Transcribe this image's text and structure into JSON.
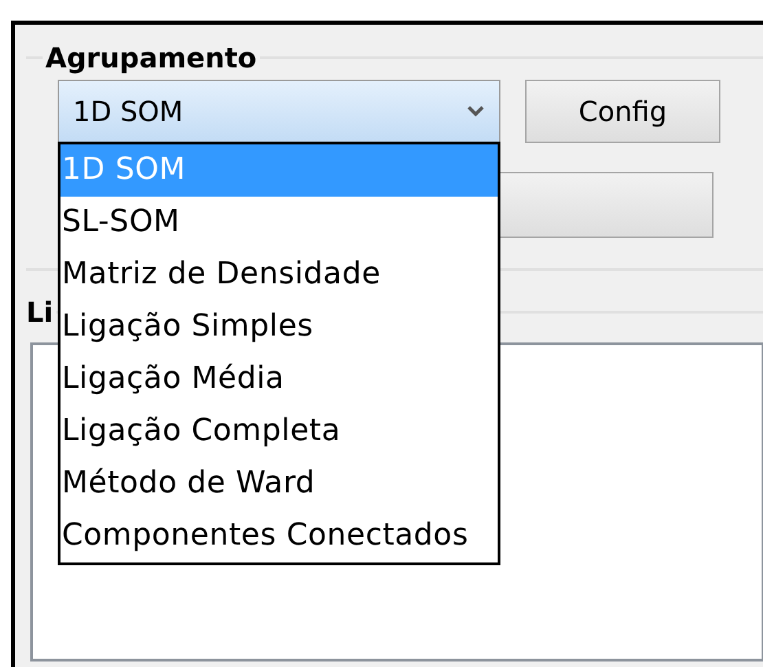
{
  "group": {
    "title": "Agrupamento"
  },
  "combo": {
    "value": "1D SOM",
    "expanded": true
  },
  "config_button": {
    "label": "Config"
  },
  "dropdown": {
    "items": [
      {
        "label": "1D SOM",
        "selected": true
      },
      {
        "label": "SL-SOM",
        "selected": false
      },
      {
        "label": "Matriz de Densidade",
        "selected": false
      },
      {
        "label": "Ligação Simples",
        "selected": false
      },
      {
        "label": "Ligação Média",
        "selected": false
      },
      {
        "label": "Ligação Completa",
        "selected": false
      },
      {
        "label": "Método de Ward",
        "selected": false
      },
      {
        "label": "Componentes Conectados",
        "selected": false
      }
    ]
  },
  "group2": {
    "title": "Li"
  }
}
